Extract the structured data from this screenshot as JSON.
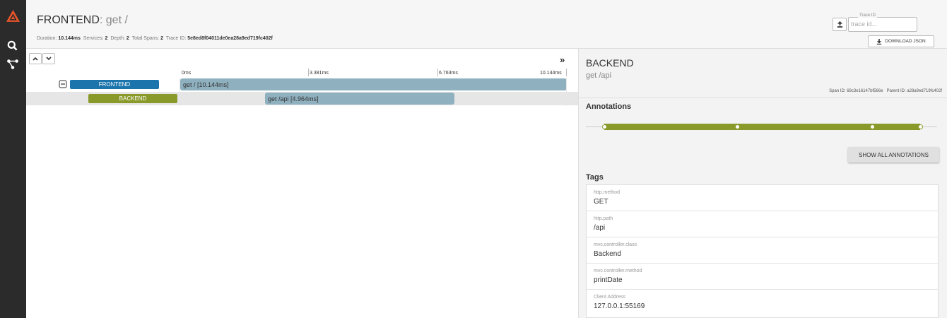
{
  "header": {
    "service": "FRONTEND",
    "separator": ": ",
    "operation": "get /",
    "meta": {
      "duration_label": "Duration:",
      "duration": "10.144ms",
      "services_label": "Services:",
      "services": "2",
      "depth_label": "Depth:",
      "depth": "2",
      "total_spans_label": "Total Spans:",
      "total_spans": "2",
      "trace_id_label": "Trace ID:",
      "trace_id": "5e8ed8f04011de0ea28a9ed719fc402f"
    },
    "trace_id_field": {
      "label": "Trace ID",
      "placeholder": "trace id..."
    },
    "download_label": "DOWNLOAD JSON"
  },
  "timeline": {
    "ticks": [
      "0ms",
      "3.381ms",
      "6.763ms",
      "10.144ms"
    ],
    "spans": [
      {
        "service": "FRONTEND",
        "label": "get / [10.144ms]"
      },
      {
        "service": "BACKEND",
        "label": "get /api [4.964ms]"
      }
    ]
  },
  "detail": {
    "service": "BACKEND",
    "operation": "get /api",
    "span_id_label": "Span ID:",
    "span_id": "69c3e16147bf566e",
    "parent_id_label": "Parent ID:",
    "parent_id": "a28a9ed719fc402f",
    "annotations_heading": "Annotations",
    "show_all_label": "SHOW ALL ANNOTATIONS",
    "tags_heading": "Tags",
    "tags": [
      {
        "key": "http.method",
        "value": "GET"
      },
      {
        "key": "http.path",
        "value": "/api"
      },
      {
        "key": "mvc.controller.class",
        "value": "Backend"
      },
      {
        "key": "mvc.controller.method",
        "value": "printDate"
      },
      {
        "key": "Client Address",
        "value": "127.0.0.1:55169"
      }
    ]
  },
  "colors": {
    "frontend": "#1b75ac",
    "backend": "#8a9a2a",
    "span_bar": "#8fb0bf",
    "logo": "#e8552a"
  },
  "icons": {
    "logo": "zipkin-logo-icon",
    "search": "search-icon",
    "dependencies": "dependencies-icon",
    "upload": "upload-icon",
    "download": "download-icon",
    "expand_up": "chevron-up-icon",
    "expand_down": "chevron-down-icon",
    "collapse_panel": "double-chevron-right-icon",
    "collapse_span": "minus-box-icon"
  }
}
